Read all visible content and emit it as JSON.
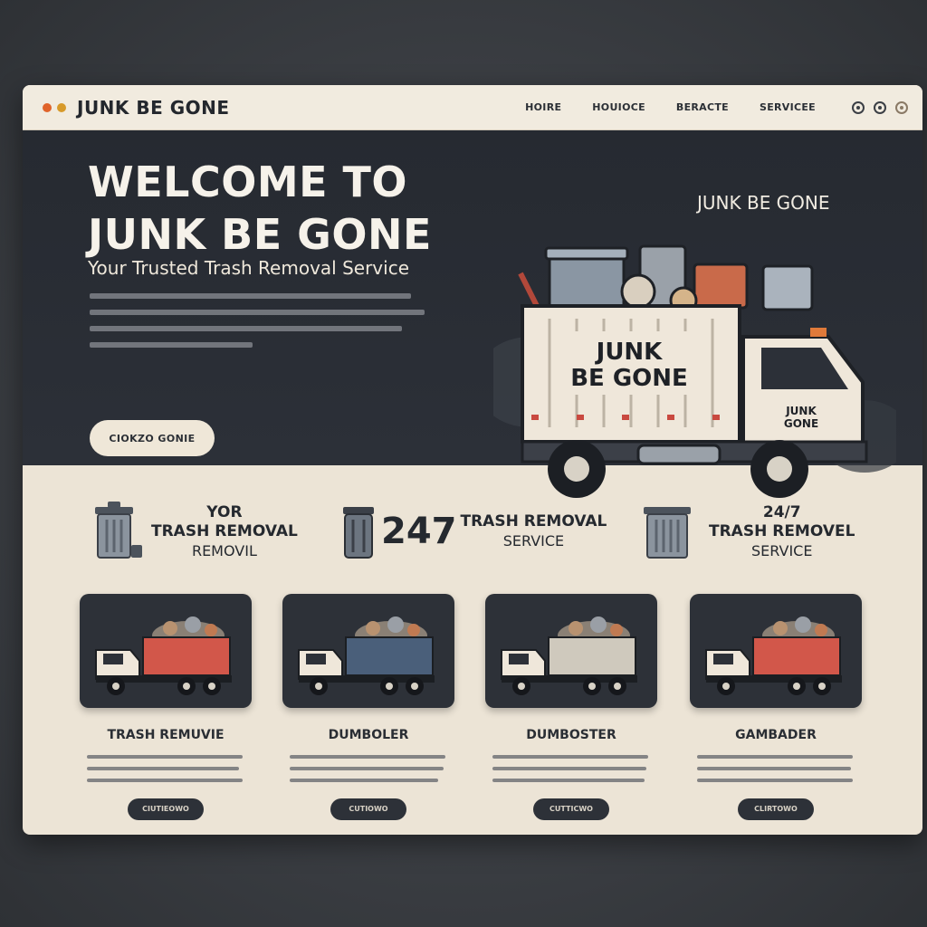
{
  "app": {
    "brand": "JUNK BE GONE",
    "accent_colors": [
      "#e0632a",
      "#d79a2a"
    ]
  },
  "nav": {
    "items": [
      "HOIRE",
      "HOUIOCE",
      "BERACTE",
      "SERVICEE"
    ]
  },
  "hero": {
    "title_line1": "WELCOME TO",
    "title_line2": "JUNK BE GONE",
    "subtitle": "Your Trusted Trash Removal Service",
    "button_label": "CIOKZO GONIE",
    "tagline": "JUNK BE GONE",
    "truck_label_line1": "JUNK",
    "truck_label_line2": "BE GONE",
    "cab_label_line1": "JUNK",
    "cab_label_line2": "GONE"
  },
  "features": [
    {
      "icon": "trash-can-icon",
      "line1": "YOR",
      "line2": "TRASH REMOVAL",
      "line3": "REMOVIL"
    },
    {
      "icon": "trash-can-icon",
      "big": "247",
      "line1": "TRASH REMOVAL",
      "line2": "SERVICE"
    },
    {
      "icon": "trash-can-icon",
      "line1": "24/7",
      "line2": "TRASH REMOVEL",
      "line3": "SERVICE"
    }
  ],
  "cards": [
    {
      "title": "TRASH REMUVIE",
      "button": "CIUTIEOWO",
      "bed_color": "#d2574a"
    },
    {
      "title": "DUMBOLER",
      "button": "CUTIOWO",
      "bed_color": "#4a5f7a"
    },
    {
      "title": "DUMBOSTER",
      "button": "CUTTICWO",
      "bed_color": "#cfc9bd"
    },
    {
      "title": "GAMBADER",
      "button": "CLIRTOWO",
      "bed_color": "#d2574a"
    }
  ]
}
